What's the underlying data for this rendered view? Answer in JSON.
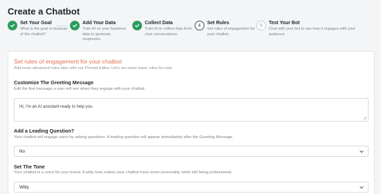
{
  "page": {
    "title": "Create a Chatbot"
  },
  "steps": [
    {
      "title": "Set Your Goal",
      "desc": "What is the goal or purpose of the chatbot?",
      "state": "done",
      "number": ""
    },
    {
      "title": "Add Your Data",
      "desc": "Train AI on your business data to generate responses.",
      "state": "done",
      "number": ""
    },
    {
      "title": "Collect Data",
      "desc": "Train AI to collect data from chat conversations.",
      "state": "done",
      "number": ""
    },
    {
      "title": "Set Rules",
      "desc": "Set rules of engagement for your chatbot.",
      "state": "active",
      "number": "4"
    },
    {
      "title": "Test Your Bot",
      "desc": "Chat with your bot to see how it engages with your audience",
      "state": "todo",
      "number": "5"
    }
  ],
  "section": {
    "title": "Set rules of engagement for your chatbot",
    "subtitle": "Add more advanced rules later with our Prompt Editor. Let's set some basic rules for now."
  },
  "greeting": {
    "label": "Customize The Greeting Message",
    "help": "Edit the first message a user will see when they engage with your chatbot.",
    "value": "Hi, I'm an AI assistant ready to help you."
  },
  "leading_question": {
    "label": "Add a Leading Question?",
    "help": "Your chatbot will engage users by asking questions. A leading question will appear immediately after the Greeting Message.",
    "value": "No"
  },
  "tone": {
    "label": "Set The Tone",
    "help": "Your chatbot is a voice for your brand. A witty tone makes your chatbot have some personality while still being professional.",
    "value": "Witty"
  },
  "colors": {
    "done": "#2a9d5c",
    "accent": "#e07050"
  }
}
